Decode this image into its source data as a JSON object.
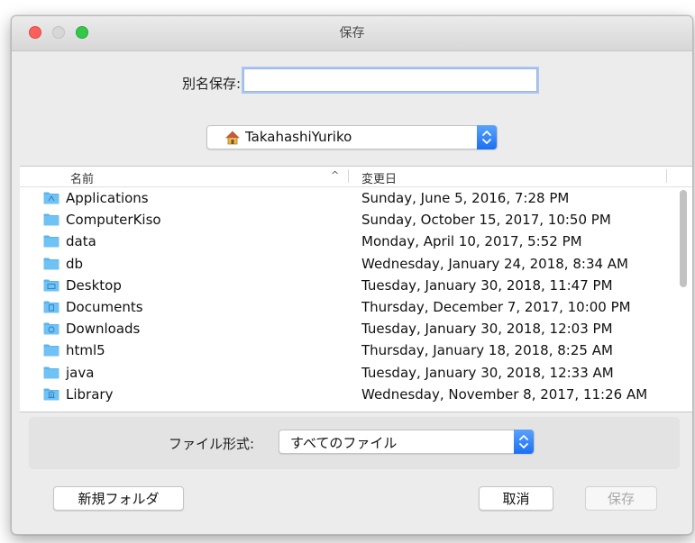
{
  "window": {
    "title": "保存"
  },
  "save_as": {
    "label": "別名保存:",
    "value": "",
    "placeholder": ""
  },
  "location": {
    "selected": "TakahashiYuriko",
    "icon": "home-icon"
  },
  "columns": {
    "name": "名前",
    "date_modified": "変更日",
    "sort_indicator": "^"
  },
  "files": [
    {
      "name": "Applications",
      "date": "Sunday, June 5, 2016, 7:28 PM",
      "icon": "applications-folder-icon"
    },
    {
      "name": "ComputerKiso",
      "date": "Sunday, October 15, 2017, 10:50 PM",
      "icon": "folder-icon"
    },
    {
      "name": "data",
      "date": "Monday, April 10, 2017, 5:52 PM",
      "icon": "folder-icon"
    },
    {
      "name": "db",
      "date": "Wednesday, January 24, 2018, 8:34 AM",
      "icon": "folder-icon"
    },
    {
      "name": "Desktop",
      "date": "Tuesday, January 30, 2018, 11:47 PM",
      "icon": "desktop-folder-icon"
    },
    {
      "name": "Documents",
      "date": "Thursday, December 7, 2017, 10:00 PM",
      "icon": "documents-folder-icon"
    },
    {
      "name": "Downloads",
      "date": "Tuesday, January 30, 2018, 12:03 PM",
      "icon": "downloads-folder-icon"
    },
    {
      "name": "html5",
      "date": "Thursday, January 18, 2018, 8:25 AM",
      "icon": "folder-icon"
    },
    {
      "name": "java",
      "date": "Tuesday, January 30, 2018, 12:33 AM",
      "icon": "folder-icon"
    },
    {
      "name": "Library",
      "date": "Wednesday, November 8, 2017, 11:26 AM",
      "icon": "library-folder-icon"
    }
  ],
  "file_format": {
    "label": "ファイル形式:",
    "selected": "すべてのファイル"
  },
  "buttons": {
    "new_folder": "新規フォルダ",
    "cancel": "取消",
    "save": "保存"
  },
  "colors": {
    "accent": "#1b6ff3",
    "folder": "#5ab4ef",
    "close": "#fc605c",
    "maximize": "#34c84a"
  }
}
